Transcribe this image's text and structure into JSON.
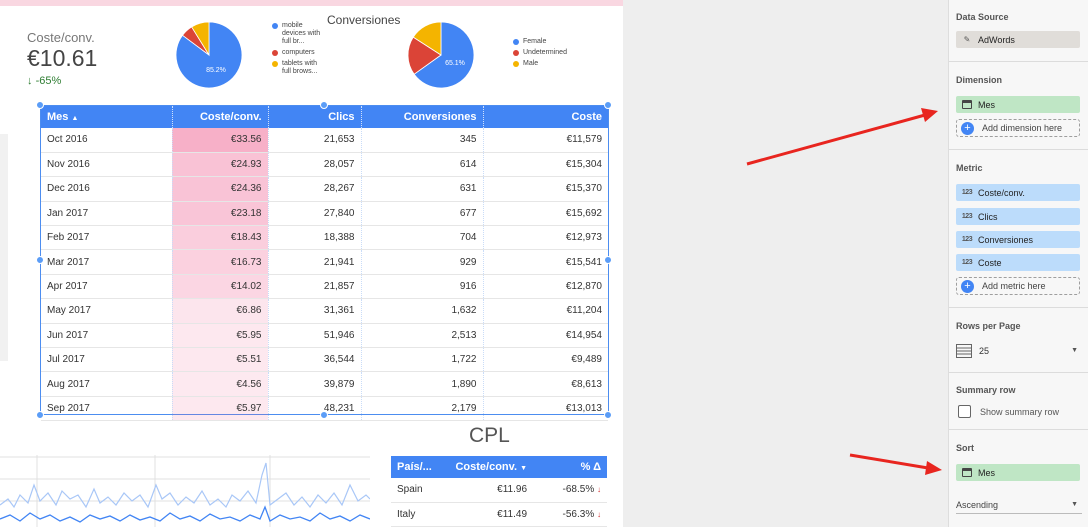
{
  "scorecard": {
    "label": "Coste/conv.",
    "value": "€10.61",
    "delta": "-65%"
  },
  "pie_device": {
    "center_label": "85.2%",
    "legend": [
      "mobile devices with full br...",
      "computers",
      "tablets with full brows..."
    ],
    "colors": [
      "#4285f4",
      "#db4437",
      "#f4b400"
    ],
    "fractions": [
      0.852,
      0.06,
      0.088
    ]
  },
  "pie_gender": {
    "title": "Conversiones",
    "center_label": "65.1%",
    "legend": [
      "Female",
      "Undetermined",
      "Male"
    ],
    "colors": [
      "#4285f4",
      "#db4437",
      "#f4b400"
    ],
    "fractions": [
      0.651,
      0.19,
      0.159
    ]
  },
  "main_table": {
    "headers": [
      "Mes",
      "Coste/conv.",
      "Clics",
      "Conversiones",
      "Coste"
    ],
    "sort_arrow": "▲",
    "rows": [
      [
        "Oct 2016",
        "€33.56",
        "21,653",
        "345",
        "€11,579"
      ],
      [
        "Nov 2016",
        "€24.93",
        "28,057",
        "614",
        "€15,304"
      ],
      [
        "Dec 2016",
        "€24.36",
        "28,267",
        "631",
        "€15,370"
      ],
      [
        "Jan 2017",
        "€23.18",
        "27,840",
        "677",
        "€15,692"
      ],
      [
        "Feb 2017",
        "€18.43",
        "18,388",
        "704",
        "€12,973"
      ],
      [
        "Mar 2017",
        "€16.73",
        "21,941",
        "929",
        "€15,541"
      ],
      [
        "Apr 2017",
        "€14.02",
        "21,857",
        "916",
        "€12,870"
      ],
      [
        "May 2017",
        "€6.86",
        "31,361",
        "1,632",
        "€11,204"
      ],
      [
        "Jun 2017",
        "€5.95",
        "51,946",
        "2,513",
        "€14,954"
      ],
      [
        "Jul 2017",
        "€5.51",
        "36,544",
        "1,722",
        "€9,489"
      ],
      [
        "Aug 2017",
        "€4.56",
        "39,879",
        "1,890",
        "€8,613"
      ],
      [
        "Sep 2017",
        "€5.97",
        "48,231",
        "2,179",
        "€13,013"
      ]
    ],
    "heat_color": "#f06292"
  },
  "cpl": {
    "title": "CPL",
    "headers": [
      "País/...",
      "Coste/conv.",
      "% Δ"
    ],
    "sort_arrow": "▼",
    "rows": [
      [
        "Spain",
        "€11.96",
        "-68.5%"
      ],
      [
        "Italy",
        "€11.49",
        "-56.3%"
      ]
    ]
  },
  "panel": {
    "data_source": {
      "title": "Data Source",
      "value": "AdWords"
    },
    "dimension": {
      "title": "Dimension",
      "value": "Mes",
      "add": "Add dimension here"
    },
    "metric": {
      "title": "Metric",
      "values": [
        "Coste/conv.",
        "Clics",
        "Conversiones",
        "Coste"
      ],
      "add": "Add metric here"
    },
    "rows_per_page": {
      "title": "Rows per Page",
      "value": "25"
    },
    "summary_row": {
      "title": "Summary row",
      "checkbox_label": "Show summary row"
    },
    "sort": {
      "title": "Sort",
      "value": "Mes",
      "order": "Ascending"
    }
  },
  "colors": {
    "accent": "#4285f4",
    "annotation_arrow": "#e8251f"
  }
}
